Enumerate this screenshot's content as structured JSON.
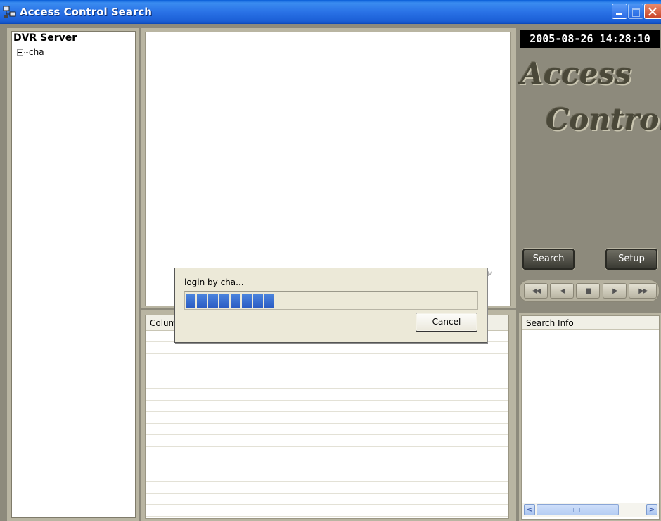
{
  "window": {
    "title": "Access Control Search"
  },
  "tree": {
    "header": "DVR Server",
    "items": [
      {
        "label": "cha",
        "expandable": true
      }
    ]
  },
  "video": {
    "mark": "M"
  },
  "list": {
    "column_header": "Colum",
    "row_count": 16
  },
  "right": {
    "clock": "2005-08-26 14:28:10",
    "logo_line1": "Access",
    "logo_line2": "Control",
    "search_label": "Search",
    "setup_label": "Setup",
    "info_header": "Search Info",
    "playback": {
      "rewind": "◀◀",
      "back": "◀",
      "stop": "■",
      "play": "▶",
      "ffwd": "▶▶"
    },
    "scroll": {
      "left": "<",
      "right": ">"
    }
  },
  "dialog": {
    "message": "login by cha...",
    "progress_segments": 8,
    "cancel_label": "Cancel"
  },
  "colors": {
    "titlebar": "#2a72e6",
    "progress": "#2a5cc4",
    "frame": "#8d8a7c"
  }
}
